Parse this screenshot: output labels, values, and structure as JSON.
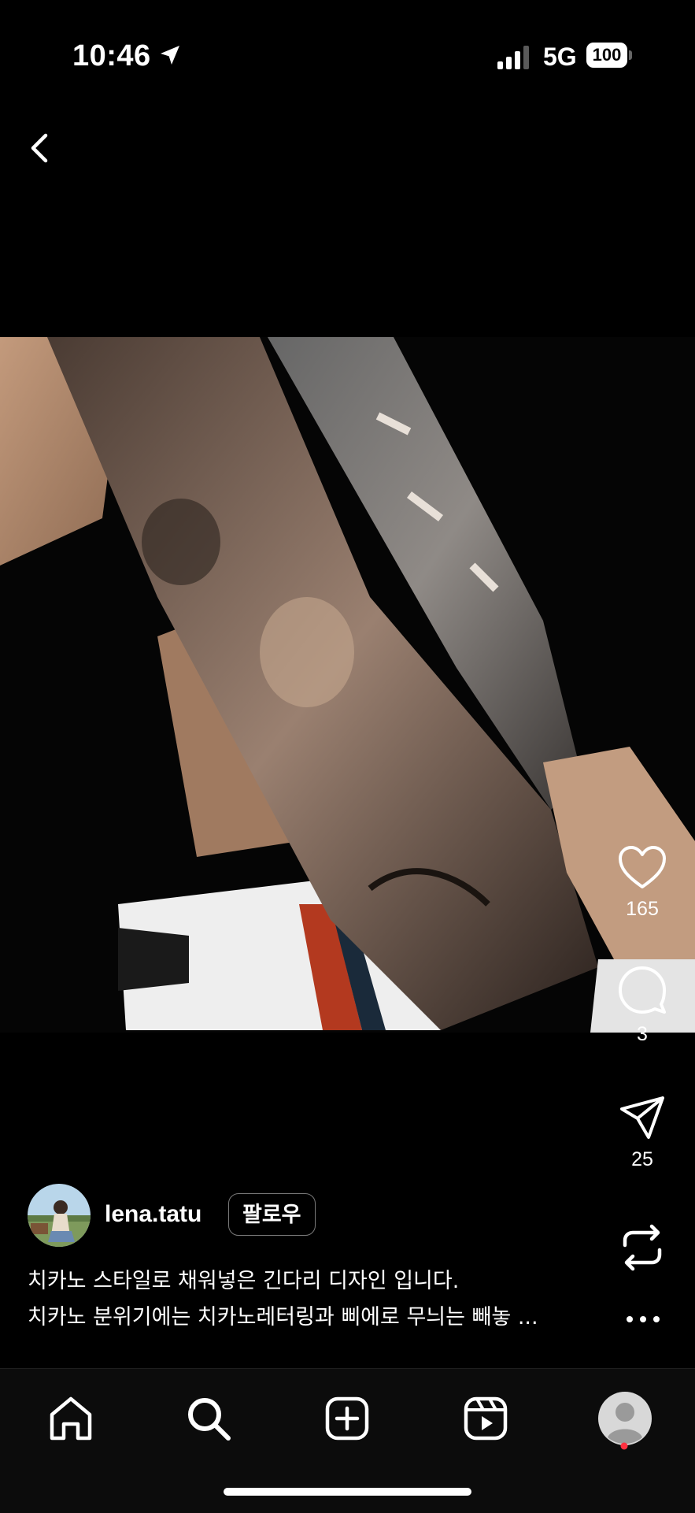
{
  "status_bar": {
    "time": "10:46",
    "network": "5G",
    "battery": "100"
  },
  "post": {
    "likes": "165",
    "comments": "3",
    "shares": "25"
  },
  "author": {
    "username": "lena.tatu",
    "follow_label": "팔로우"
  },
  "caption": {
    "line1": "치카노 스타일로 채워넣은 긴다리 디자인 입니다.",
    "line2": "치카노 분위기에는 치카노레터링과 삐에로 무늬는 빼놓 ..."
  },
  "tab_bar": {
    "items": [
      "home-icon",
      "search-icon",
      "create-icon",
      "reels-icon",
      "profile-icon"
    ],
    "notification_color": "#ff3040"
  }
}
